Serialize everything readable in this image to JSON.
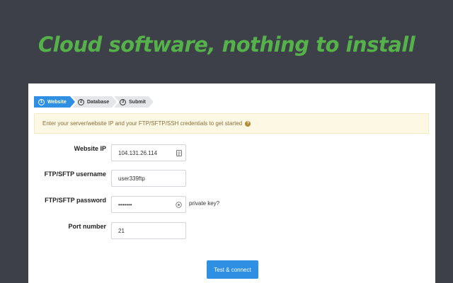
{
  "headline": "Cloud software, nothing to install",
  "steps": [
    {
      "num": "1",
      "label": "Website"
    },
    {
      "num": "2",
      "label": "Database"
    },
    {
      "num": "3",
      "label": "Submit"
    }
  ],
  "info_text": "Enter your server/website IP and your FTP/SFTP/SSH credentials to get started",
  "form": {
    "website_ip_label": "Website IP",
    "website_ip_value": "104.131.26.114",
    "username_label": "FTP/SFTP username",
    "username_value": "user339ftp",
    "password_label": "FTP/SFTP password",
    "password_value": "•••••••",
    "private_key_label": "private key?",
    "port_label": "Port number",
    "port_value": "21"
  },
  "submit_label": "Test & connect",
  "colors": {
    "accent": "#2f8fe3",
    "headline": "#55b24a",
    "background": "#3d4048",
    "info_bg": "#fcf8e3"
  }
}
